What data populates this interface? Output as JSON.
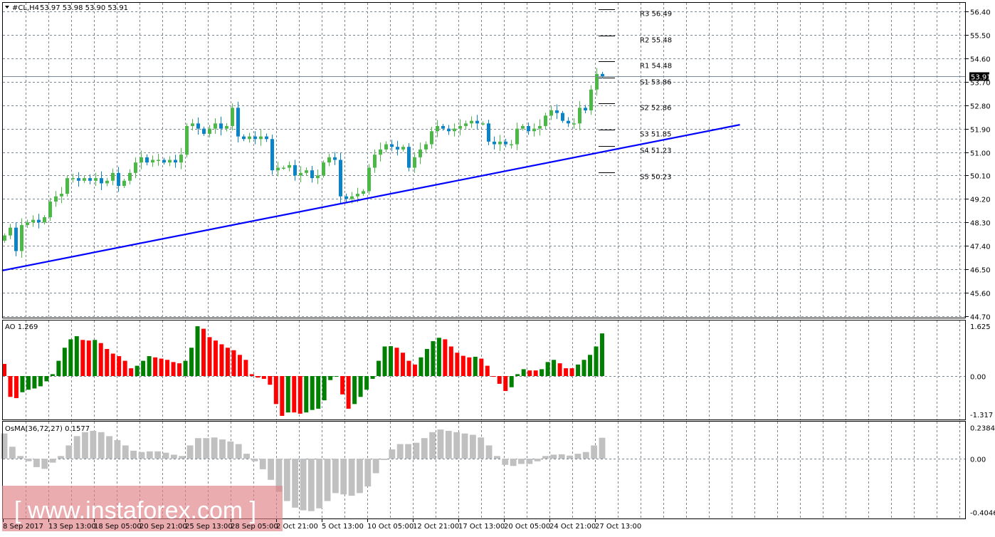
{
  "header": {
    "symbol": "#CL,H4",
    "ohlc": "53.97 53.98 53.90 53.91"
  },
  "current_price": {
    "value": 53.91,
    "label": "53.91"
  },
  "colors": {
    "bull": "#4cb848",
    "bear": "#0a84c6",
    "trendline": "#0000ff",
    "ao_up": "#008000",
    "ao_down": "#ff0000",
    "osma": "#c0c0c0",
    "watermark": "#e07f85"
  },
  "watermark": {
    "text": "[ www.instaforex.com ]"
  },
  "chart_data": [
    {
      "type": "candlestick",
      "title": "#CL,H4",
      "ylim": [
        44.7,
        56.4
      ],
      "yticks": [
        "56.40",
        "55.50",
        "54.60",
        "53.70",
        "52.80",
        "51.90",
        "51.00",
        "50.10",
        "49.20",
        "48.30",
        "47.40",
        "46.50",
        "45.60",
        "44.70"
      ],
      "xticks": [
        "8 Sep 2017",
        "13 Sep 13:00",
        "18 Sep 05:00",
        "20 Sep 21:00",
        "25 Sep 13:00",
        "28 Sep 05:00",
        "2 Oct 21:00",
        "5 Oct 13:00",
        "10 Oct 05:00",
        "12 Oct 21:00",
        "17 Oct 13:00",
        "20 Oct 05:00",
        "24 Oct 21:00",
        "27 Oct 13:00"
      ],
      "grid": true,
      "closes": [
        47.8,
        48.1,
        47.2,
        48.2,
        48.3,
        48.4,
        48.3,
        48.5,
        49.1,
        49.3,
        49.4,
        50.0,
        50.0,
        49.9,
        50.0,
        49.9,
        50.0,
        49.8,
        49.9,
        50.2,
        49.7,
        49.9,
        50.2,
        50.6,
        50.8,
        50.6,
        50.7,
        50.7,
        50.6,
        50.7,
        50.6,
        50.9,
        52.0,
        52.1,
        51.9,
        51.7,
        51.9,
        52.1,
        51.9,
        52.0,
        52.7,
        51.6,
        51.5,
        51.6,
        51.5,
        51.6,
        51.5,
        50.3,
        50.4,
        50.4,
        50.5,
        50.1,
        50.2,
        50.3,
        50.0,
        50.1,
        50.6,
        50.8,
        50.7,
        49.3,
        49.2,
        49.3,
        49.4,
        49.5,
        50.4,
        50.9,
        51.1,
        51.3,
        51.2,
        51.1,
        51.2,
        50.4,
        50.8,
        51.1,
        51.3,
        51.8,
        52.0,
        51.9,
        51.8,
        51.9,
        52.0,
        52.1,
        52.2,
        52.1,
        52.1,
        51.4,
        51.3,
        51.4,
        51.3,
        51.3,
        51.9,
        52.0,
        51.8,
        51.9,
        52.0,
        52.4,
        52.6,
        52.5,
        52.2,
        52.1,
        52.1,
        52.7,
        52.6,
        53.4,
        54.0,
        53.91
      ],
      "pivots": [
        {
          "label": "R3 56.49",
          "value": 56.49
        },
        {
          "label": "R2 55.48",
          "value": 55.48
        },
        {
          "label": "R1 54.48",
          "value": 54.48
        },
        {
          "label": "S1 53.86",
          "value": 53.86
        },
        {
          "label": "S2 52.86",
          "value": 52.86
        },
        {
          "label": "S3 51.85",
          "value": 51.85
        },
        {
          "label": "S4 51.23",
          "value": 51.23
        },
        {
          "label": "S5 50.23",
          "value": 50.23
        }
      ],
      "trendline": {
        "from_bar": -0.4,
        "from_price": 46.45,
        "to_bar": 129.2,
        "to_price": 52.05
      }
    },
    {
      "type": "bar",
      "title": "AO 1.269",
      "ylim": [
        -1.317,
        1.625
      ],
      "yticks": [
        "1.625",
        "0.00",
        "-1.317"
      ],
      "values": [
        0.39,
        -0.67,
        -0.71,
        -0.52,
        -0.44,
        -0.4,
        -0.33,
        -0.17,
        0.06,
        0.49,
        0.91,
        1.18,
        1.28,
        1.16,
        1.14,
        1.16,
        1.06,
        0.87,
        0.72,
        0.64,
        0.49,
        0.25,
        0.33,
        0.49,
        0.64,
        0.6,
        0.56,
        0.52,
        0.45,
        0.41,
        0.49,
        0.91,
        1.6,
        1.52,
        1.25,
        1.14,
        1.02,
        0.91,
        0.83,
        0.68,
        0.52,
        0.06,
        -0.05,
        -0.09,
        -0.28,
        -0.9,
        -1.28,
        -1.17,
        -1.17,
        -1.21,
        -1.17,
        -1.09,
        -1.05,
        -0.78,
        -0.13,
        -0.02,
        -0.59,
        -1.05,
        -0.9,
        -0.67,
        -0.44,
        -0.09,
        0.49,
        0.95,
        0.96,
        0.91,
        0.75,
        0.49,
        0.37,
        0.6,
        0.87,
        1.12,
        1.23,
        1.18,
        0.95,
        0.75,
        0.65,
        0.6,
        0.62,
        0.56,
        0.33,
        -0.02,
        -0.25,
        -0.48,
        -0.36,
        0.06,
        0.22,
        0.18,
        0.18,
        0.22,
        0.45,
        0.52,
        0.41,
        0.25,
        0.25,
        0.37,
        0.52,
        0.68,
        0.95,
        1.37
      ]
    },
    {
      "type": "bar",
      "title": "OsMA(36,72,27) 0.1577",
      "ylim": [
        -0.4046,
        0.2384
      ],
      "yticks": [
        "0.2384",
        "0.00",
        "-0.4046"
      ],
      "values": [
        0.19,
        0.09,
        0.02,
        -0.02,
        -0.064,
        -0.077,
        -0.03,
        0.02,
        0.1,
        0.17,
        0.2,
        0.21,
        0.2,
        0.17,
        0.14,
        0.1,
        0.06,
        0.05,
        0.055,
        0.055,
        0.045,
        0.03,
        0.02,
        0.1,
        0.155,
        0.155,
        0.16,
        0.145,
        0.13,
        0.11,
        0.037,
        -0.02,
        -0.08,
        -0.16,
        -0.25,
        -0.32,
        -0.37,
        -0.39,
        -0.396,
        -0.375,
        -0.32,
        -0.26,
        -0.27,
        -0.28,
        -0.26,
        -0.21,
        -0.11,
        -0.01,
        0.07,
        0.11,
        0.11,
        0.12,
        0.155,
        0.2,
        0.22,
        0.21,
        0.2,
        0.19,
        0.18,
        0.16,
        0.1,
        0.02,
        -0.047,
        -0.055,
        -0.04,
        -0.04,
        -0.02,
        0.02,
        0.03,
        0.033,
        0.023,
        0.037,
        0.05,
        0.1,
        0.1577
      ]
    }
  ]
}
